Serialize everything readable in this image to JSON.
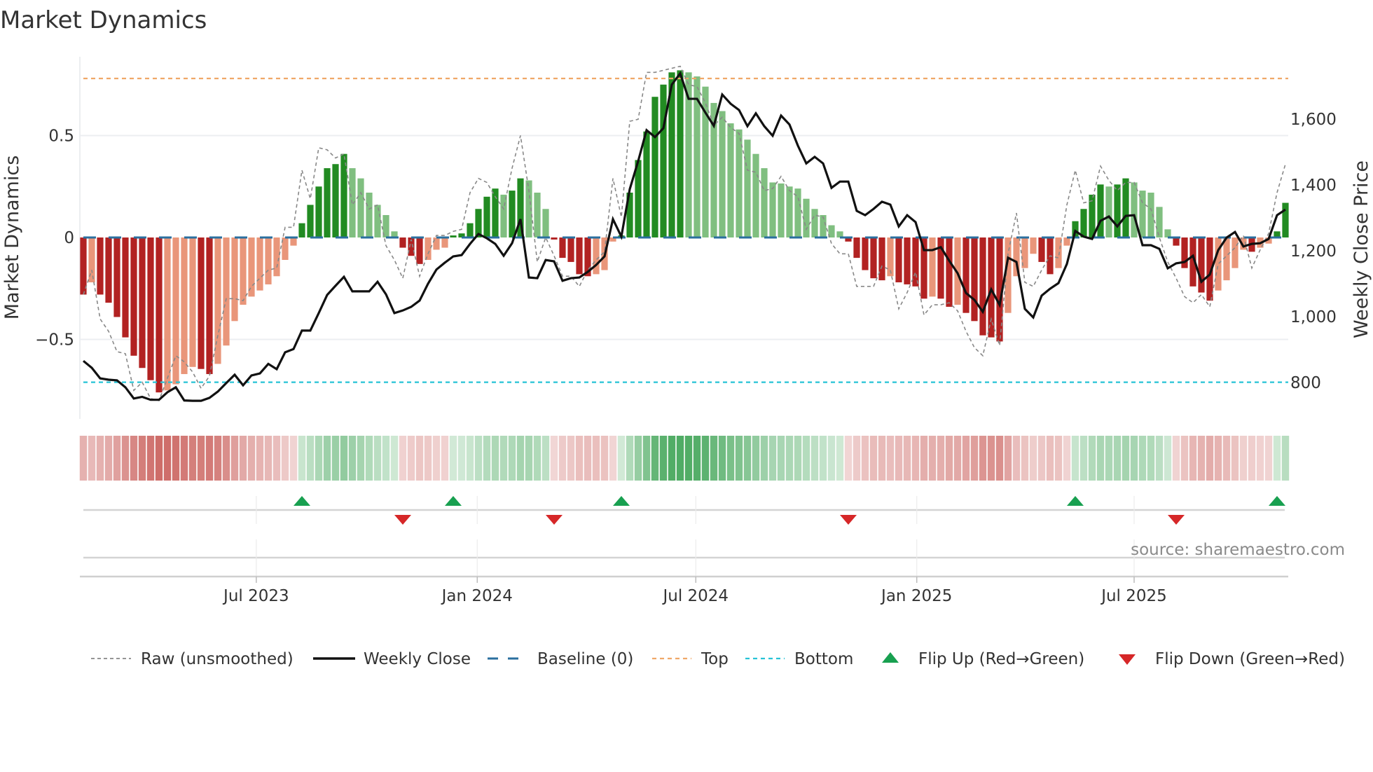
{
  "title": "Market Dynamics",
  "source": "source: sharemaestro.com",
  "chart_data": {
    "type": "bar",
    "title": "Market Dynamics",
    "ylabel": "Market Dynamics",
    "y2label": "Weekly Close Price",
    "ylim": [
      -0.88,
      0.9
    ],
    "y2lim": [
      700,
      1800
    ],
    "yticks": [
      {
        "v": 0.5,
        "label": "0.5"
      },
      {
        "v": 0,
        "label": "0"
      },
      {
        "v": -0.5,
        "label": "−0.5"
      }
    ],
    "y2ticks": [
      {
        "v": 1600,
        "label": "1,600"
      },
      {
        "v": 1400,
        "label": "1,400"
      },
      {
        "v": 1200,
        "label": "1,200"
      },
      {
        "v": 1000,
        "label": "1,000"
      },
      {
        "v": 800,
        "label": "800"
      }
    ],
    "xticks": [
      {
        "date": "2023-07-01",
        "label": "Jul 2023"
      },
      {
        "date": "2024-01-01",
        "label": "Jan 2024"
      },
      {
        "date": "2024-07-01",
        "label": "Jul 2024"
      },
      {
        "date": "2025-01-01",
        "label": "Jan 2025"
      },
      {
        "date": "2025-07-01",
        "label": "Jul 2025"
      }
    ],
    "x_start": "2023-02-07",
    "x_step_days": 7,
    "top_level": 0.78,
    "bottom_level": -0.71,
    "grid": true,
    "legend_position": "bottom",
    "colors": {
      "up_strong": "#228b22",
      "up_weak": "#80bf80",
      "down_strong": "#b22222",
      "down_weak": "#e9967a",
      "close": "#111111",
      "raw": "#888888",
      "baseline": "#2a6f9f",
      "top": "#f0a868",
      "bottom": "#27c3d6",
      "flip_up": "#18a050",
      "flip_down": "#d62728"
    },
    "legend": [
      {
        "key": "raw",
        "label": "Raw (unsmoothed)"
      },
      {
        "key": "close",
        "label": "Weekly Close"
      },
      {
        "key": "baseline",
        "label": "Baseline (0)"
      },
      {
        "key": "top",
        "label": "Top"
      },
      {
        "key": "bottom",
        "label": "Bottom"
      },
      {
        "key": "flip_up",
        "label": "Flip Up (Red→Green)"
      },
      {
        "key": "flip_down",
        "label": "Flip Down (Green→Red)"
      }
    ],
    "dynamics": [
      -0.28,
      -0.22,
      -0.28,
      -0.32,
      -0.39,
      -0.49,
      -0.58,
      -0.64,
      -0.7,
      -0.76,
      -0.75,
      -0.72,
      -0.67,
      -0.635,
      -0.645,
      -0.67,
      -0.62,
      -0.53,
      -0.41,
      -0.33,
      -0.29,
      -0.26,
      -0.23,
      -0.19,
      -0.11,
      -0.04,
      0.07,
      0.16,
      0.25,
      0.34,
      0.36,
      0.41,
      0.34,
      0.29,
      0.22,
      0.16,
      0.11,
      0.03,
      -0.05,
      -0.09,
      -0.13,
      -0.11,
      -0.06,
      -0.05,
      0.01,
      0.02,
      0.07,
      0.14,
      0.2,
      0.24,
      0.21,
      0.23,
      0.29,
      0.28,
      0.22,
      0.14,
      -0.01,
      -0.1,
      -0.12,
      -0.18,
      -0.19,
      -0.18,
      -0.16,
      -0.02,
      0.01,
      0.22,
      0.38,
      0.52,
      0.69,
      0.75,
      0.81,
      0.82,
      0.81,
      0.79,
      0.74,
      0.66,
      0.62,
      0.56,
      0.53,
      0.48,
      0.41,
      0.34,
      0.27,
      0.265,
      0.25,
      0.24,
      0.19,
      0.14,
      0.11,
      0.06,
      0.03,
      -0.02,
      -0.1,
      -0.16,
      -0.2,
      -0.21,
      -0.19,
      -0.22,
      -0.23,
      -0.24,
      -0.3,
      -0.29,
      -0.3,
      -0.34,
      -0.33,
      -0.37,
      -0.41,
      -0.48,
      -0.49,
      -0.51,
      -0.37,
      -0.19,
      -0.15,
      -0.08,
      -0.12,
      -0.18,
      -0.15,
      -0.04,
      0.08,
      0.14,
      0.21,
      0.26,
      0.25,
      0.26,
      0.29,
      0.27,
      0.23,
      0.22,
      0.15,
      0.04,
      -0.04,
      -0.15,
      -0.24,
      -0.27,
      -0.31,
      -0.26,
      -0.21,
      -0.15,
      -0.06,
      -0.07,
      -0.05,
      -0.03,
      0.03,
      0.17
    ],
    "raw": [
      -0.28,
      -0.16,
      -0.4,
      -0.46,
      -0.56,
      -0.57,
      -0.75,
      -0.71,
      -0.79,
      -0.8,
      -0.69,
      -0.58,
      -0.61,
      -0.66,
      -0.74,
      -0.68,
      -0.48,
      -0.3,
      -0.3,
      -0.31,
      -0.24,
      -0.2,
      -0.16,
      -0.15,
      0.05,
      0.05,
      0.33,
      0.19,
      0.44,
      0.43,
      0.39,
      0.41,
      0.16,
      0.22,
      0.14,
      0.16,
      -0.04,
      -0.11,
      -0.2,
      -0.01,
      -0.19,
      -0.08,
      0.01,
      0.01,
      0.03,
      0.04,
      0.22,
      0.29,
      0.27,
      0.2,
      0.14,
      0.34,
      0.5,
      0.23,
      -0.12,
      0.0,
      -0.09,
      -0.19,
      -0.19,
      -0.24,
      -0.16,
      -0.11,
      -0.07,
      0.29,
      0.1,
      0.57,
      0.58,
      0.81,
      0.81,
      0.82,
      0.83,
      0.84,
      0.75,
      0.74,
      0.66,
      0.55,
      0.59,
      0.54,
      0.51,
      0.33,
      0.32,
      0.23,
      0.24,
      0.3,
      0.23,
      0.2,
      0.04,
      0.11,
      0.1,
      -0.03,
      -0.08,
      -0.08,
      -0.24,
      -0.24,
      -0.24,
      -0.14,
      -0.16,
      -0.35,
      -0.27,
      -0.17,
      -0.38,
      -0.33,
      -0.33,
      -0.32,
      -0.36,
      -0.46,
      -0.54,
      -0.58,
      -0.4,
      -0.53,
      -0.08,
      0.12,
      -0.22,
      -0.24,
      -0.16,
      -0.09,
      -0.1,
      0.16,
      0.33,
      0.17,
      0.18,
      0.35,
      0.28,
      0.23,
      0.27,
      0.27,
      0.17,
      0.14,
      0.0,
      -0.12,
      -0.2,
      -0.29,
      -0.32,
      -0.28,
      -0.34,
      -0.13,
      -0.09,
      -0.05,
      0.01,
      -0.15,
      -0.06,
      0.02,
      0.22,
      0.36
    ],
    "close": [
      866,
      845,
      813,
      809,
      807,
      786,
      752,
      757,
      748,
      748,
      771,
      786,
      746,
      745,
      745,
      754,
      773,
      799,
      824,
      792,
      822,
      828,
      857,
      841,
      892,
      902,
      958,
      958,
      1011,
      1066,
      1094,
      1121,
      1077,
      1077,
      1077,
      1106,
      1068,
      1011,
      1019,
      1030,
      1049,
      1100,
      1143,
      1164,
      1183,
      1187,
      1221,
      1251,
      1238,
      1221,
      1185,
      1223,
      1296,
      1119,
      1117,
      1172,
      1168,
      1109,
      1117,
      1119,
      1136,
      1157,
      1183,
      1296,
      1243,
      1387,
      1472,
      1566,
      1545,
      1572,
      1704,
      1738,
      1661,
      1661,
      1619,
      1579,
      1674,
      1646,
      1627,
      1578,
      1617,
      1578,
      1549,
      1610,
      1583,
      1519,
      1465,
      1485,
      1465,
      1391,
      1410,
      1410,
      1321,
      1308,
      1327,
      1349,
      1340,
      1274,
      1308,
      1287,
      1202,
      1202,
      1211,
      1170,
      1132,
      1072,
      1051,
      1015,
      1083,
      1036,
      1179,
      1166,
      1024,
      998,
      1064,
      1085,
      1102,
      1160,
      1260,
      1243,
      1236,
      1291,
      1304,
      1274,
      1306,
      1308,
      1217,
      1217,
      1206,
      1147,
      1162,
      1166,
      1185,
      1106,
      1128,
      1202,
      1240,
      1257,
      1213,
      1221,
      1223,
      1236,
      1308,
      1325
    ]
  }
}
